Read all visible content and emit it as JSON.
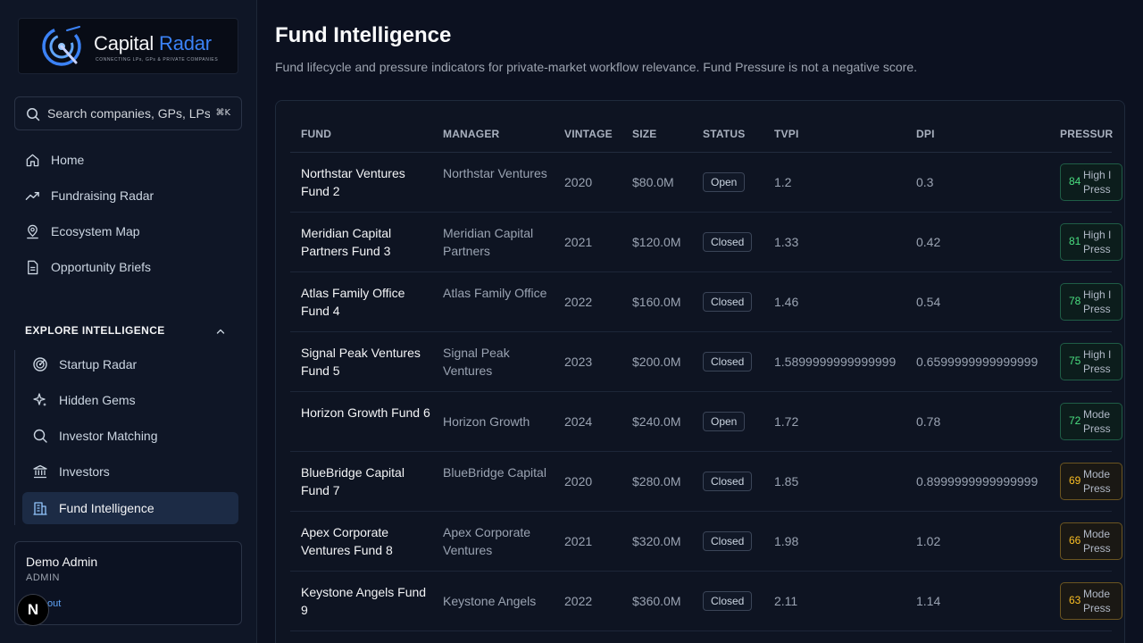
{
  "brand": {
    "name_main": "Capital",
    "name_accent": "Radar",
    "tagline": "CONNECTING LPs, GPs & PRIVATE COMPANIES",
    "accent_color": "#3b82f6"
  },
  "search": {
    "placeholder": "Search companies, GPs, LPs",
    "shortcut": "⌘K"
  },
  "nav": [
    {
      "label": "Home",
      "icon": "home-icon"
    },
    {
      "label": "Fundraising Radar",
      "icon": "trending-up-icon"
    },
    {
      "label": "Ecosystem Map",
      "icon": "map-pin-icon"
    },
    {
      "label": "Opportunity Briefs",
      "icon": "document-icon"
    }
  ],
  "explore": {
    "heading": "EXPLORE INTELLIGENCE",
    "items": [
      {
        "label": "Startup Radar",
        "icon": "radar-icon"
      },
      {
        "label": "Hidden Gems",
        "icon": "sparkles-icon"
      },
      {
        "label": "Investor Matching",
        "icon": "search-icon"
      },
      {
        "label": "Investors",
        "icon": "bank-icon"
      },
      {
        "label": "Fund Intelligence",
        "icon": "building-icon",
        "active": true
      }
    ]
  },
  "user": {
    "name": "Demo Admin",
    "role": "ADMIN",
    "logout": "out"
  },
  "dev_badge": "N",
  "page": {
    "title": "Fund Intelligence",
    "subtitle": "Fund lifecycle and pressure indicators for private-market workflow relevance. Fund Pressure is not a negative score."
  },
  "table": {
    "headers": [
      "FUND",
      "MANAGER",
      "VINTAGE",
      "SIZE",
      "STATUS",
      "TVPI",
      "DPI",
      "PRESSUR"
    ],
    "rows": [
      {
        "fund": "Northstar Ventures Fund 2",
        "manager": "Northstar Ventures",
        "vintage": "2020",
        "size": "$80.0M",
        "status": "Open",
        "tvpi": "1.2",
        "dpi": "0.3",
        "pressure_score": "84",
        "pressure_label": "High I\nPress",
        "level": "high"
      },
      {
        "fund": "Meridian Capital Partners Fund 3",
        "manager": "Meridian Capital Partners",
        "vintage": "2021",
        "size": "$120.0M",
        "status": "Closed",
        "tvpi": "1.33",
        "dpi": "0.42",
        "pressure_score": "81",
        "pressure_label": "High I\nPress",
        "level": "high"
      },
      {
        "fund": "Atlas Family Office Fund 4",
        "manager": "Atlas Family Office",
        "vintage": "2022",
        "size": "$160.0M",
        "status": "Closed",
        "tvpi": "1.46",
        "dpi": "0.54",
        "pressure_score": "78",
        "pressure_label": "High I\nPress",
        "level": "high"
      },
      {
        "fund": "Signal Peak Ventures Fund 5",
        "manager": "Signal Peak Ventures",
        "vintage": "2023",
        "size": "$200.0M",
        "status": "Closed",
        "tvpi": "1.5899999999999999",
        "dpi": "0.6599999999999999",
        "pressure_score": "75",
        "pressure_label": "High I\nPress",
        "level": "high"
      },
      {
        "fund": "Horizon Growth Fund 6",
        "manager": "Horizon Growth",
        "vintage": "2024",
        "size": "$240.0M",
        "status": "Open",
        "tvpi": "1.72",
        "dpi": "0.78",
        "pressure_score": "72",
        "pressure_label": "Mode\nPress",
        "level": "high"
      },
      {
        "fund": "BlueBridge Capital Fund 7",
        "manager": "BlueBridge Capital",
        "vintage": "2020",
        "size": "$280.0M",
        "status": "Closed",
        "tvpi": "1.85",
        "dpi": "0.8999999999999999",
        "pressure_score": "69",
        "pressure_label": "Mode\nPress",
        "level": "mod"
      },
      {
        "fund": "Apex Corporate Ventures Fund 8",
        "manager": "Apex Corporate Ventures",
        "vintage": "2021",
        "size": "$320.0M",
        "status": "Closed",
        "tvpi": "1.98",
        "dpi": "1.02",
        "pressure_score": "66",
        "pressure_label": "Mode\nPress",
        "level": "mod"
      },
      {
        "fund": "Keystone Angels Fund 9",
        "manager": "Keystone Angels",
        "vintage": "2022",
        "size": "$360.0M",
        "status": "Closed",
        "tvpi": "2.11",
        "dpi": "1.14",
        "pressure_score": "63",
        "pressure_label": "Mode\nPress",
        "level": "mod"
      }
    ]
  }
}
